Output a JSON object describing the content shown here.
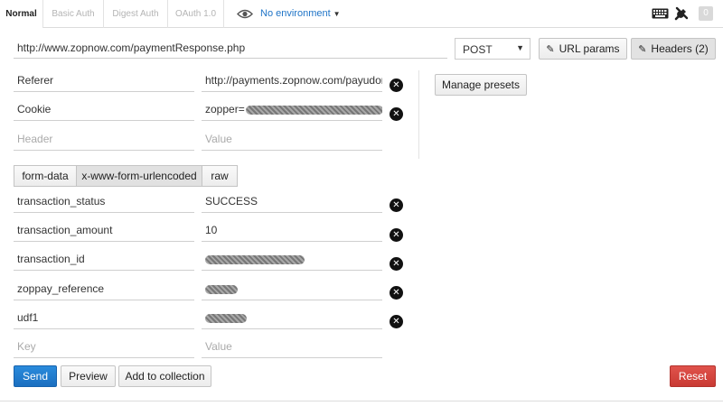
{
  "auth_tabs": [
    "Normal",
    "Basic Auth",
    "Digest Auth",
    "OAuth 1.0"
  ],
  "environment": {
    "label": "No environment"
  },
  "badge_count": "0",
  "request": {
    "url": "http://www.zopnow.com/paymentResponse.php",
    "method": "POST"
  },
  "buttons": {
    "url_params": "URL params",
    "headers": "Headers (2)",
    "manage_presets": "Manage presets",
    "send": "Send",
    "preview": "Preview",
    "add_to_collection": "Add to collection",
    "reset": "Reset"
  },
  "headers": {
    "rows": [
      {
        "key": "Referer",
        "value": "http://payments.zopnow.com/payudone"
      },
      {
        "key": "Cookie",
        "value": "zopper="
      }
    ],
    "key_placeholder": "Header",
    "value_placeholder": "Value"
  },
  "body_types": [
    "form-data",
    "x-www-form-urlencoded",
    "raw"
  ],
  "body": {
    "rows": [
      {
        "key": "transaction_status",
        "value": "SUCCESS"
      },
      {
        "key": "transaction_amount",
        "value": "10"
      },
      {
        "key": "transaction_id",
        "value": ""
      },
      {
        "key": "zoppay_reference",
        "value": ""
      },
      {
        "key": "udf1",
        "value": ""
      }
    ],
    "key_placeholder": "Key",
    "value_placeholder": "Value"
  },
  "colors": {
    "link_blue": "#1f74c7",
    "send_blue": "#1b6fc0",
    "reset_red": "#c93a33"
  },
  "icons": [
    "eye-icon",
    "keyboard-icon",
    "tools-icon",
    "edit-icon",
    "remove-icon"
  ]
}
